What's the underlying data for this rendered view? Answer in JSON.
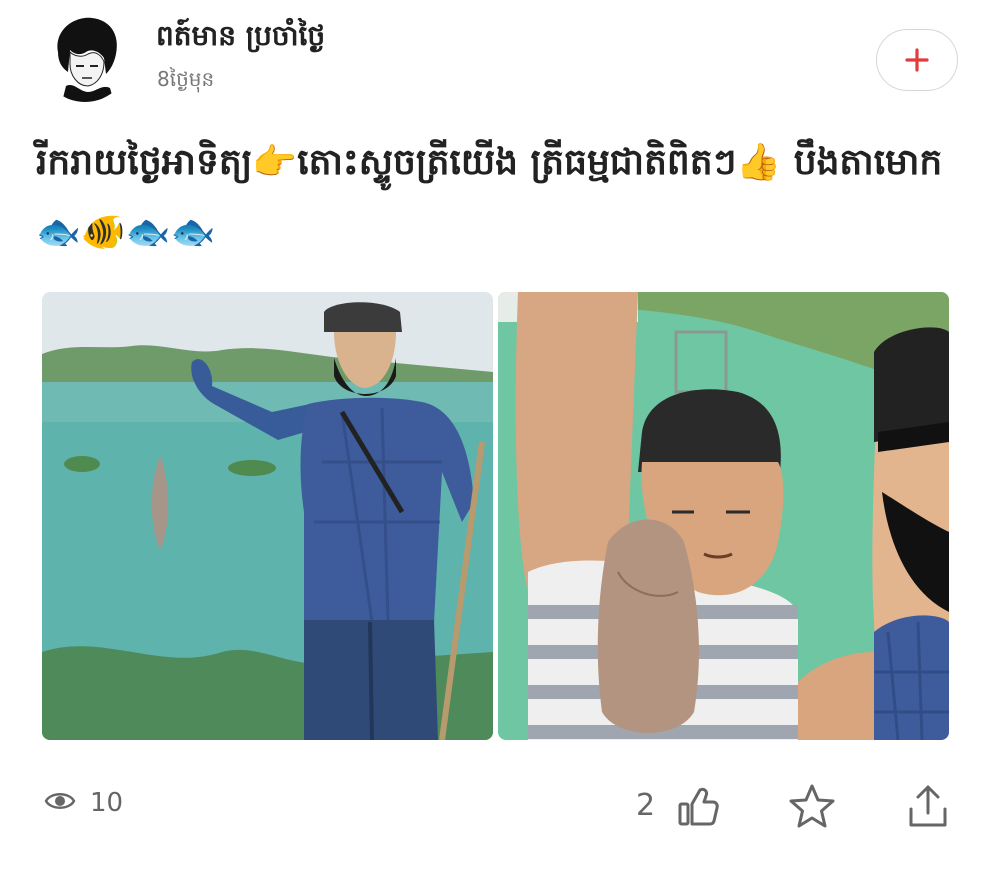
{
  "post": {
    "author": "ពត៍មាន ប្រចាំថ្ងៃ",
    "time": "8ថ្ងៃមុន",
    "text": "រីករាយថ្ងៃអាទិត្យ👉តោះស្ទូចត្រីយើង ត្រីធម្មជាតិពិតៗ👍 បឹងតាមោក🐟🐠🐟🐟",
    "views": "10",
    "likes": "2"
  },
  "icons": {
    "follow": "plus-icon",
    "views": "eye-icon",
    "like": "thumbs-up-icon",
    "favorite": "star-icon",
    "share": "share-icon"
  },
  "colors": {
    "accent": "#e23b3b",
    "muted": "#666666"
  }
}
